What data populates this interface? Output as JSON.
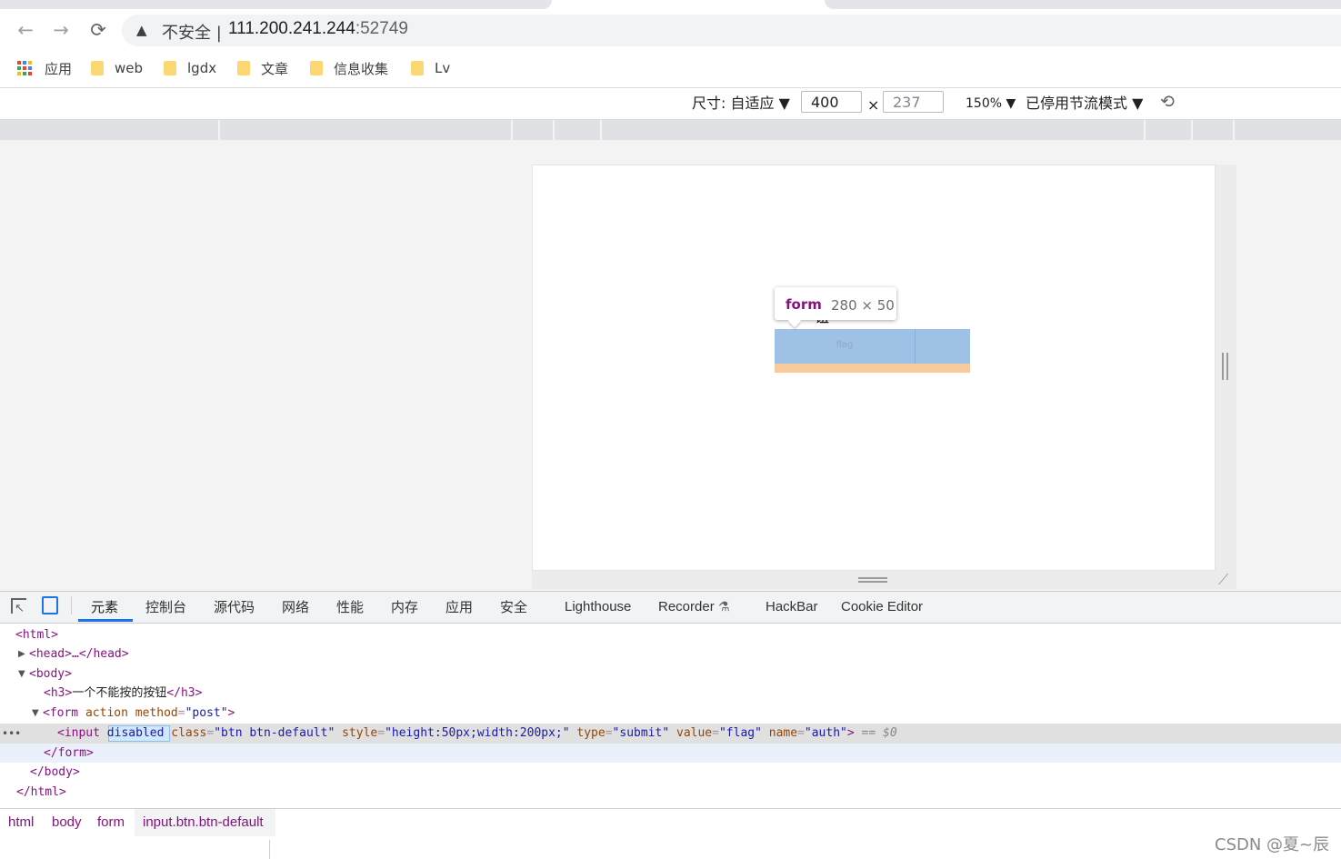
{
  "browser": {
    "nav_back": "←",
    "nav_forward": "→",
    "nav_reload": "⟳",
    "insecure_label": "不安全 |",
    "url_host": "111.200.241.244",
    "url_port": ":52749",
    "bookmarks": [
      "应用",
      "web",
      "lgdx",
      "文章",
      "信息收集",
      "Lv"
    ]
  },
  "device_toolbar": {
    "dimensions_label": "尺寸: 自适应 ▼",
    "width": "400",
    "times": "×",
    "height": "237",
    "zoom": "150% ▼",
    "throttle": "已停用节流模式 ▼"
  },
  "page": {
    "h3_visible": "钮",
    "button_value": "flag",
    "tooltip_tag": "form",
    "tooltip_size": "280 × 50"
  },
  "devtools": {
    "tabs": [
      "元素",
      "控制台",
      "源代码",
      "网络",
      "性能",
      "内存",
      "应用",
      "安全",
      "Lighthouse",
      "Recorder",
      "HackBar",
      "Cookie Editor"
    ],
    "active_tab": "元素",
    "dom": {
      "html_open": "<html>",
      "head": "<head>…</head>",
      "body_open": "<body>",
      "h3_open": "<h3>",
      "h3_text": "一个不能按的按钮",
      "h3_close": "</h3>",
      "form_open": "<form",
      "form_attr1": "action",
      "form_attr2": "method",
      "form_attr2_val": "\"post\"",
      "input_open": "<input",
      "input_disabled": "disabled",
      "attr_class": "class",
      "val_class": "\"btn btn-default\"",
      "attr_style": "style",
      "val_style": "\"height:50px;width:200px;\"",
      "attr_type": "type",
      "val_type": "\"submit\"",
      "attr_value": "value",
      "val_value": "\"flag\"",
      "attr_name": "name",
      "val_name": "\"auth\"",
      "eq_dollar": "== $0",
      "form_close": "</form>",
      "body_close": "</body>",
      "html_close": "</html>"
    },
    "breadcrumbs": [
      "html",
      "body",
      "form",
      "input.btn.btn-default"
    ]
  },
  "watermark": "CSDN @夏~辰"
}
